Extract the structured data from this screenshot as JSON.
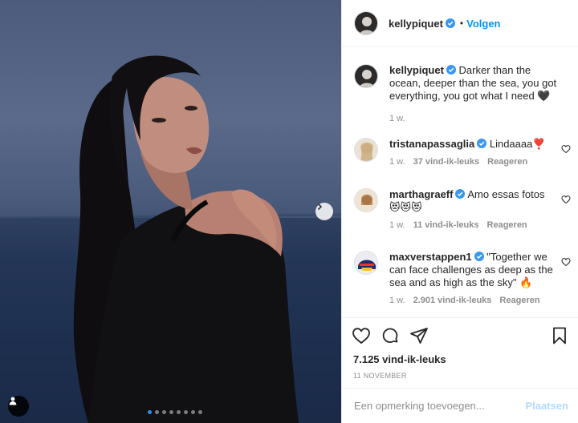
{
  "post": {
    "username": "kellypiquet",
    "separator": "•",
    "follow_label": "Volgen"
  },
  "caption": {
    "username": "kellypiquet",
    "text": "Darker than the ocean, deeper than the sea, you got everything, you got what I need 🖤",
    "time": "1 w."
  },
  "comments": [
    {
      "username": "tristanapassaglia",
      "text": "Lindaaaa❣️",
      "time": "1 w.",
      "likes": "37 vind-ik-leuks",
      "reply": "Reageren"
    },
    {
      "username": "marthagraeff",
      "text": "Amo essas fotos 😻😻😻",
      "time": "1 w.",
      "likes": "11 vind-ik-leuks",
      "reply": "Reageren"
    },
    {
      "username": "maxverstappen1",
      "text": "\"Together we can face challenges as deep as the sea and as high as the sky\" 🔥",
      "time": "1 w.",
      "likes": "2.901 vind-ik-leuks",
      "reply": "Reageren"
    }
  ],
  "actions": {
    "likes_count": "7.125 vind-ik-leuks",
    "date": "11 NOVEMBER"
  },
  "add_comment": {
    "placeholder": "Een opmerking toevoegen...",
    "post_label": "Plaatsen"
  },
  "carousel": {
    "total": 8,
    "active_index": 0
  },
  "colors": {
    "link_blue": "#0095f6",
    "post_disabled": "#b3dbff",
    "verified_blue": "#3897f0",
    "muted": "#8e8e8e"
  }
}
